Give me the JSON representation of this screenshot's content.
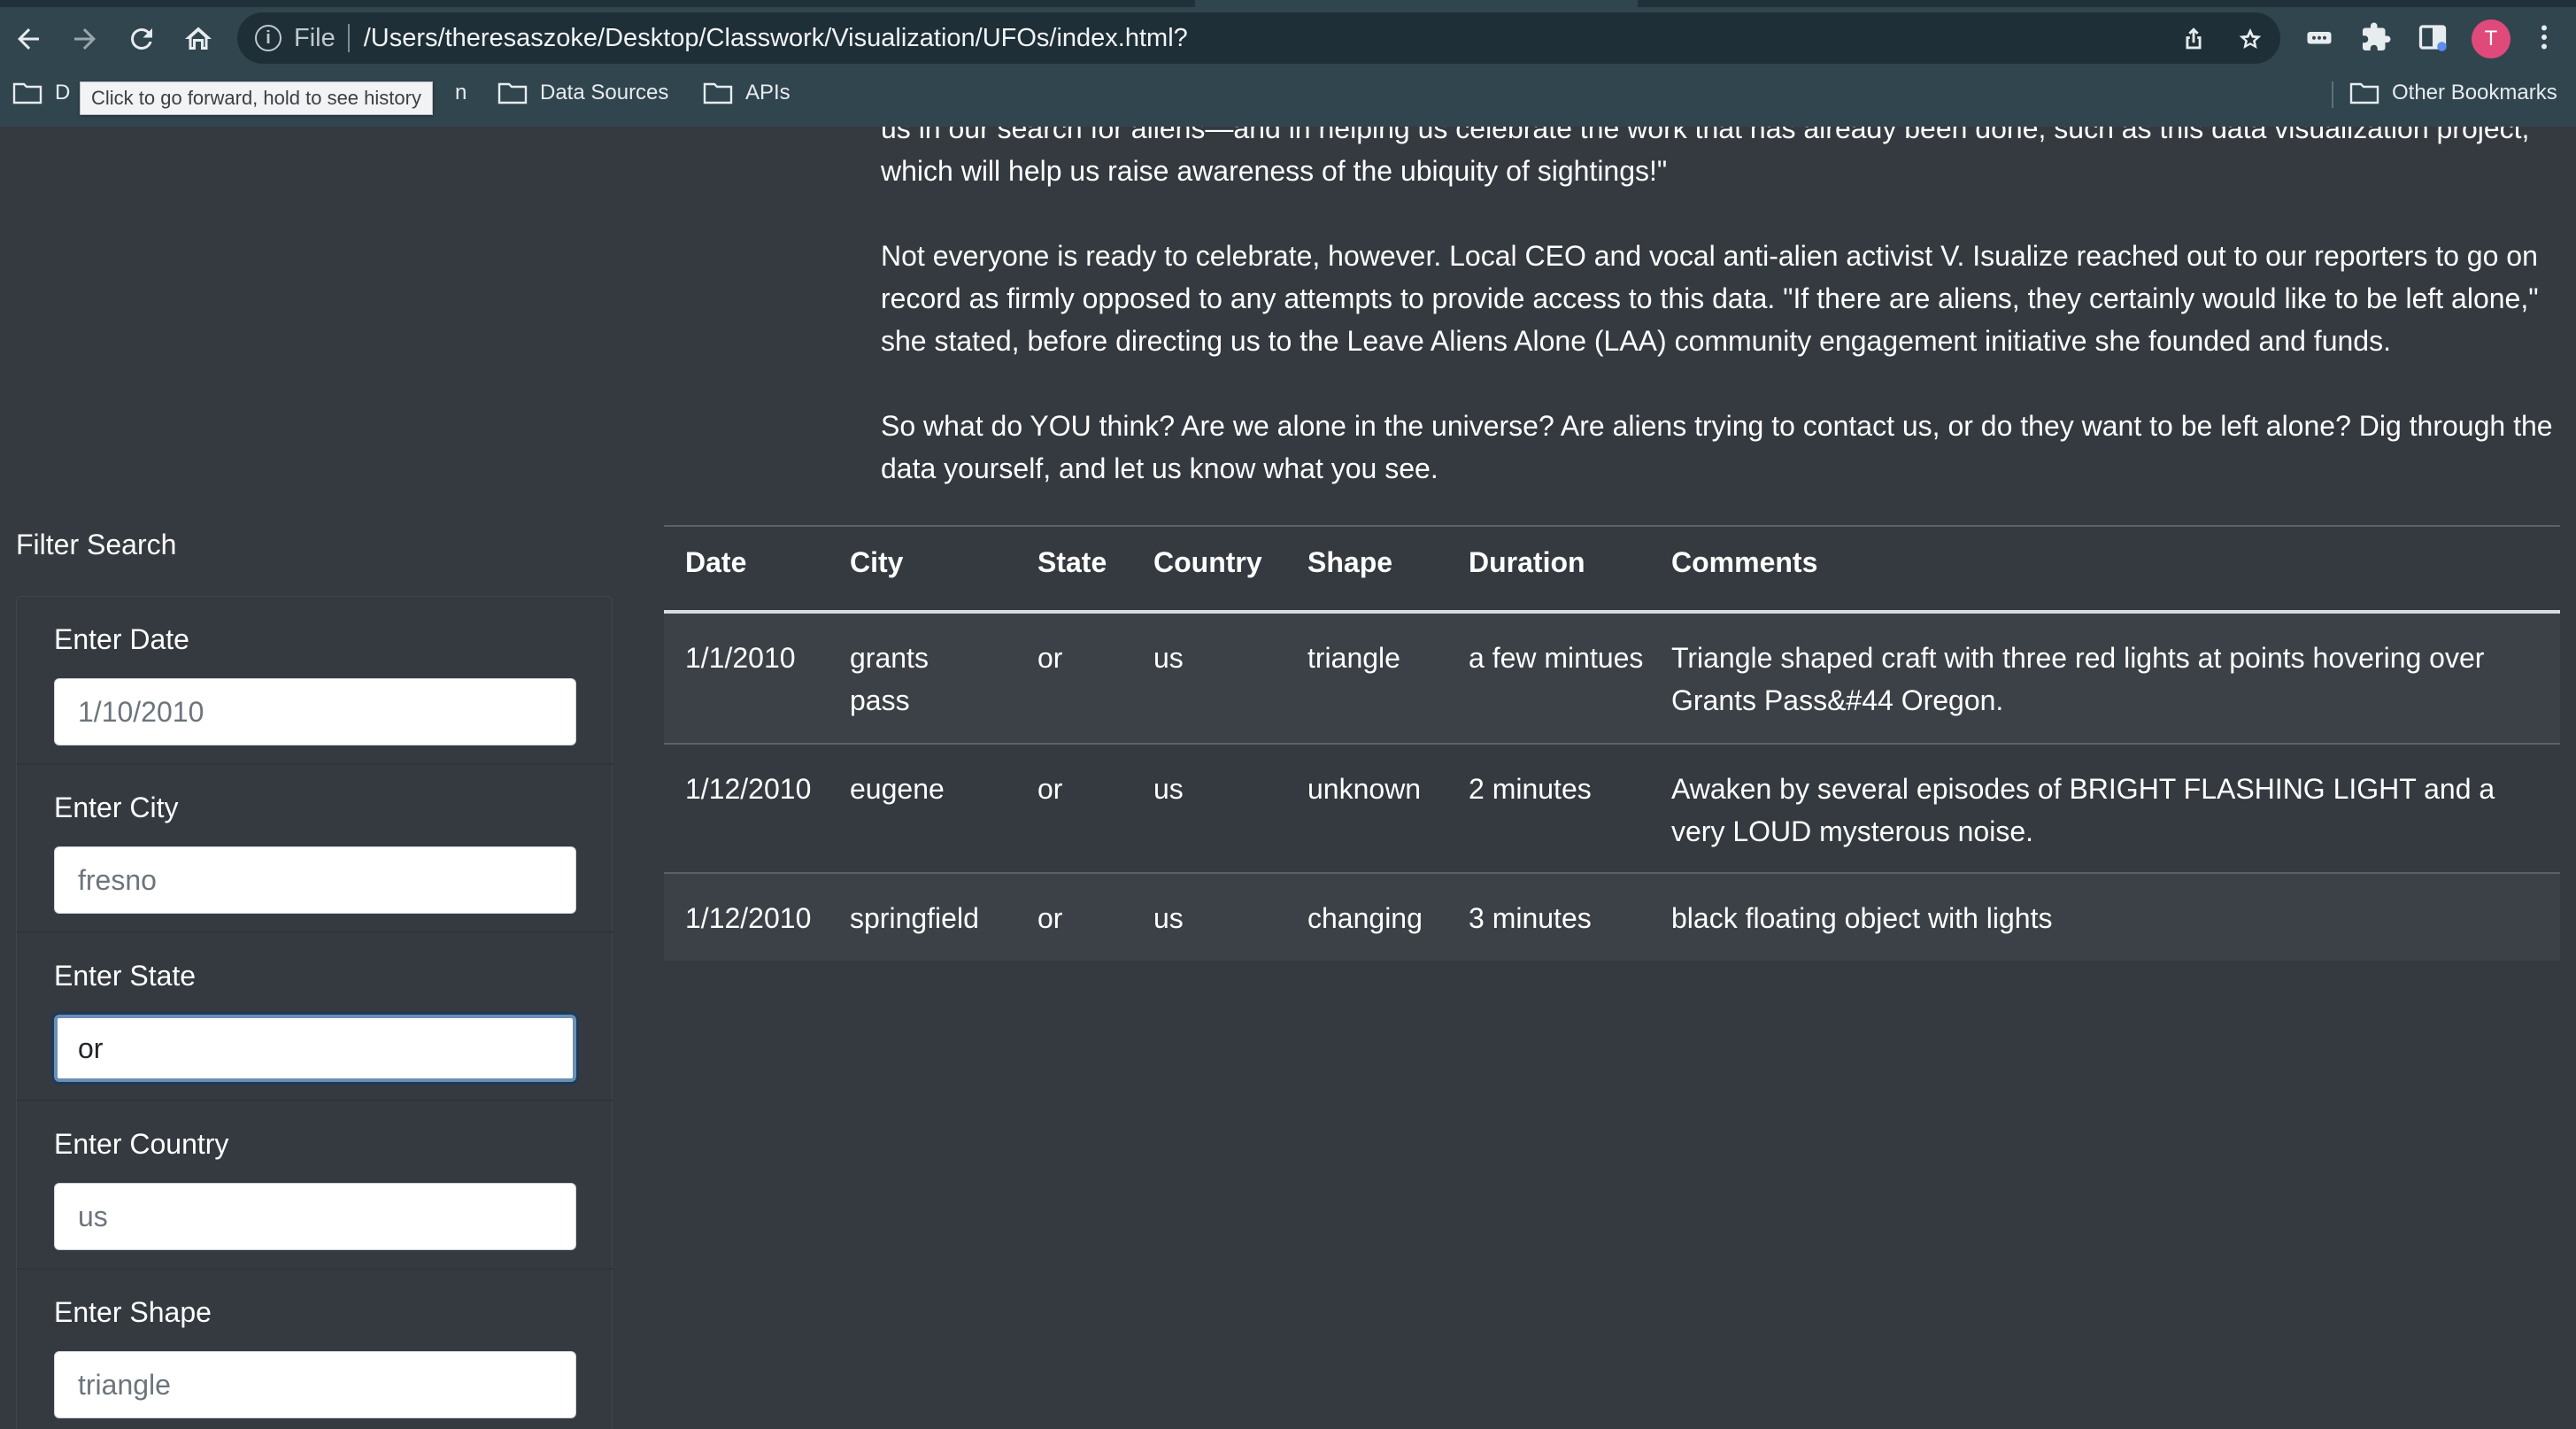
{
  "browser": {
    "scheme_label": "File",
    "url": "/Users/theresaszoke/Desktop/Classwork/Visualization/UFOs/index.html?",
    "avatar_letter": "T",
    "bookmarks": {
      "first_partial": "D",
      "partial_hidden_suffix": "n",
      "data_sources": "Data Sources",
      "apis": "APIs",
      "other": "Other Bookmarks"
    },
    "tooltip": "Click to go forward, hold to see history"
  },
  "article": {
    "paragraphs": [
      "us in our search for aliens—and in helping us celebrate the work that has already been done, such as this data visualization project, which will help us raise awareness of the ubiquity of sightings!\"",
      "Not everyone is ready to celebrate, however. Local CEO and vocal anti-alien activist V. Isualize reached out to our reporters to go on record as firmly opposed to any attempts to provide access to this data. \"If there are aliens, they certainly would like to be left alone,\" she stated, before directing us to the Leave Aliens Alone (LAA) community engagement initiative she founded and funds.",
      "So what do YOU think? Are we alone in the universe? Are aliens trying to contact us, or do they want to be left alone? Dig through the data yourself, and let us know what you see."
    ]
  },
  "filter": {
    "title": "Filter Search",
    "fields": [
      {
        "label": "Enter Date",
        "value": "1/10/2010"
      },
      {
        "label": "Enter City",
        "value": "fresno"
      },
      {
        "label": "Enter State",
        "value": "or"
      },
      {
        "label": "Enter Country",
        "value": "us"
      },
      {
        "label": "Enter Shape",
        "value": "triangle"
      }
    ]
  },
  "table": {
    "headers": [
      "Date",
      "City",
      "State",
      "Country",
      "Shape",
      "Duration",
      "Comments"
    ],
    "rows": [
      [
        "1/1/2010",
        "grants pass",
        "or",
        "us",
        "triangle",
        "a few mintues",
        "Triangle shaped craft with three red lights at points hovering over Grants Pass&#44 Oregon."
      ],
      [
        "1/12/2010",
        "eugene",
        "or",
        "us",
        "unknown",
        "2 minutes",
        "Awaken by several episodes of BRIGHT FLASHING LIGHT and a very LOUD mysterous noise."
      ],
      [
        "1/12/2010",
        "springfield",
        "or",
        "us",
        "changing",
        "3 minutes",
        "black floating object with lights"
      ]
    ]
  }
}
